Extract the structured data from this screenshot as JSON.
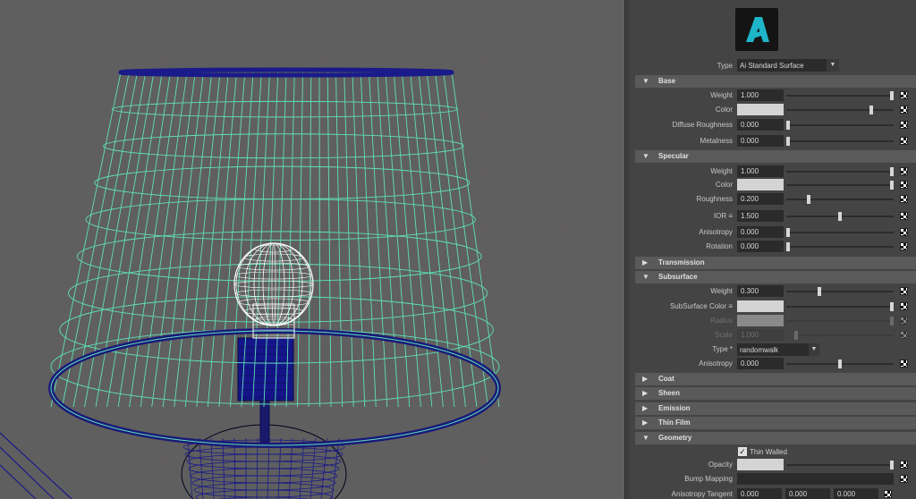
{
  "viewport": {
    "description_icon": "lamp-wireframe"
  },
  "panel": {
    "logo_icon": "arnold-logo",
    "type_label": "Type",
    "type_value": "Ai Standard Surface",
    "sections": {
      "base": "Base",
      "specular": "Specular",
      "transmission": "Transmission",
      "subsurface": "Subsurface",
      "coat": "Coat",
      "sheen": "Sheen",
      "emission": "Emission",
      "thin_film": "Thin Film",
      "geometry": "Geometry"
    },
    "base": {
      "weight": {
        "label": "Weight",
        "value": "1.000",
        "level": 1.0
      },
      "color": {
        "label": "Color",
        "level": 0.8
      },
      "diffuse_roughness": {
        "label": "Diffuse Roughness",
        "value": "0.000",
        "level": 0.0
      },
      "metalness": {
        "label": "Metalness",
        "value": "0.000",
        "level": 0.0
      }
    },
    "specular": {
      "weight": {
        "label": "Weight",
        "value": "1.000",
        "level": 1.0
      },
      "color": {
        "label": "Color",
        "level": 1.0
      },
      "roughness": {
        "label": "Roughness",
        "value": "0.200",
        "level": 0.2
      },
      "ior": {
        "label": "IOR ≡",
        "value": "1.500",
        "level": 0.5
      },
      "anisotropy": {
        "label": "Anisotropy",
        "value": "0.000",
        "level": 0.0
      },
      "rotation": {
        "label": "Rotation",
        "value": "0.000",
        "level": 0.0
      }
    },
    "subsurface": {
      "weight": {
        "label": "Weight",
        "value": "0.300",
        "level": 0.3
      },
      "color": {
        "label": "SubSurface Color ≡",
        "level": 1.0
      },
      "radius": {
        "label": "Radius"
      },
      "scale": {
        "label": "Scale",
        "value": "1.000",
        "level": 0.0
      },
      "type": {
        "label": "Type *",
        "value": "randomwalk"
      },
      "anisotropy": {
        "label": "Anisotropy",
        "value": "0.000",
        "level": 0.5
      }
    },
    "geometry": {
      "thin_walled": {
        "label": "Thin Walled",
        "checked": true
      },
      "opacity": {
        "label": "Opacity",
        "level": 1.0
      },
      "bump_mapping": {
        "label": "Bump Mapping"
      },
      "anisotropy_tangent": {
        "label": "Anisotropy Tangent",
        "values": [
          "0.000",
          "0.000",
          "0.000"
        ]
      }
    },
    "colors": {
      "accent": "#1fb5c9",
      "wire_shade": "#00001e",
      "wire_mesh": "#5fe0b8",
      "bulb": "#ffffff"
    }
  }
}
